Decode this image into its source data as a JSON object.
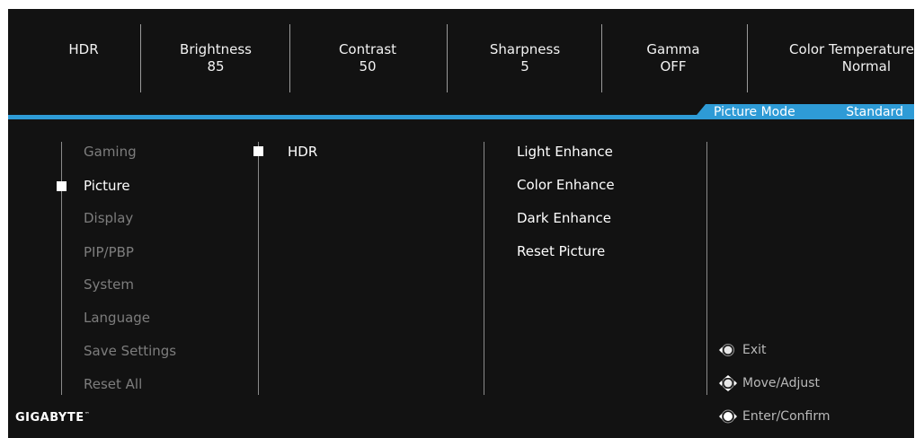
{
  "top_stats": [
    {
      "label": "HDR",
      "value": ""
    },
    {
      "label": "Brightness",
      "value": "85"
    },
    {
      "label": "Contrast",
      "value": "50"
    },
    {
      "label": "Sharpness",
      "value": "5"
    },
    {
      "label": "Gamma",
      "value": "OFF"
    },
    {
      "label": "Color Temperature",
      "value": "Normal"
    }
  ],
  "picture_mode": {
    "label": "Picture Mode",
    "value": "Standard"
  },
  "main_menu": [
    {
      "label": "Gaming",
      "active": false
    },
    {
      "label": "Picture",
      "active": true
    },
    {
      "label": "Display",
      "active": false
    },
    {
      "label": "PIP/PBP",
      "active": false
    },
    {
      "label": "System",
      "active": false
    },
    {
      "label": "Language",
      "active": false
    },
    {
      "label": "Save Settings",
      "active": false
    },
    {
      "label": "Reset All",
      "active": false
    }
  ],
  "submenu": [
    {
      "label": "HDR",
      "selected": true
    }
  ],
  "options": [
    "Light Enhance",
    "Color Enhance",
    "Dark Enhance",
    "Reset Picture"
  ],
  "hints": [
    {
      "icon": "joystick-left-icon",
      "label": "Exit"
    },
    {
      "icon": "joystick-four-way-icon",
      "label": "Move/Adjust"
    },
    {
      "icon": "joystick-press-icon",
      "label": "Enter/Confirm"
    }
  ],
  "brand": {
    "name": "GIGABYTE",
    "tm": "™"
  },
  "colors": {
    "accent": "#2e9bd6",
    "background": "#121212",
    "inactive_text": "#7d7d7d"
  }
}
